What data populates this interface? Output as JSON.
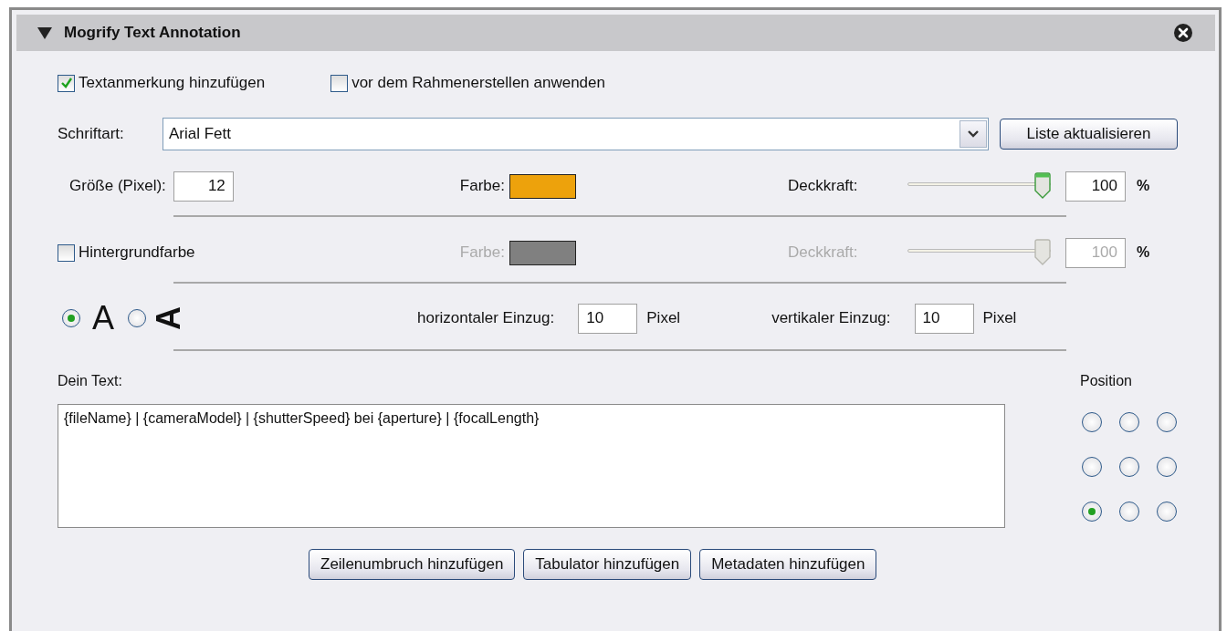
{
  "panel": {
    "title": "Mogrify Text Annotation",
    "expanded": true
  },
  "options": [
    {
      "label": "Textanmerkung hinzufügen",
      "checked": true
    },
    {
      "label": "vor dem Rahmenerstellen anwenden",
      "checked": false
    }
  ],
  "font": {
    "label": "Schriftart:",
    "value": "Arial Fett",
    "button": "Liste aktualisieren"
  },
  "text_style": {
    "size_label": "Größe (Pixel):",
    "size": "12",
    "color_label": "Farbe:",
    "color": "#eda20c",
    "opacity_label": "Deckkraft:",
    "level": 1,
    "opacity_value": "100",
    "unit": "%"
  },
  "background": {
    "label": "Hintergrundfarbe",
    "checked": false,
    "color_label": "Farbe:",
    "color": "#808080",
    "opacity_label": "Deckkraft:",
    "level": 1,
    "opacity_value": "100",
    "unit": "%"
  },
  "orientation": [
    {
      "kind": "horizontal",
      "glyph": "A",
      "selected": true
    },
    {
      "kind": "rotated",
      "glyph": "A",
      "selected": false
    }
  ],
  "indents": [
    {
      "label": "horizontaler Einzug:",
      "value": "10",
      "unit": "Pixel"
    },
    {
      "label": "vertikaler Einzug:",
      "value": "10",
      "unit": "Pixel"
    }
  ],
  "text": {
    "label": "Dein Text:",
    "value": "{fileName} | {cameraModel} | {shutterSpeed} bei {aperture} | {focalLength}"
  },
  "position": {
    "label": "Position",
    "cells": [
      {
        "selected": false
      },
      {
        "selected": false
      },
      {
        "selected": false
      },
      {
        "selected": false
      },
      {
        "selected": false
      },
      {
        "selected": false
      },
      {
        "selected": true
      },
      {
        "selected": false
      },
      {
        "selected": false
      }
    ]
  },
  "buttons": [
    "Zeilenumbruch hinzufügen",
    "Tabulator hinzufügen",
    "Metadaten hinzufügen"
  ]
}
